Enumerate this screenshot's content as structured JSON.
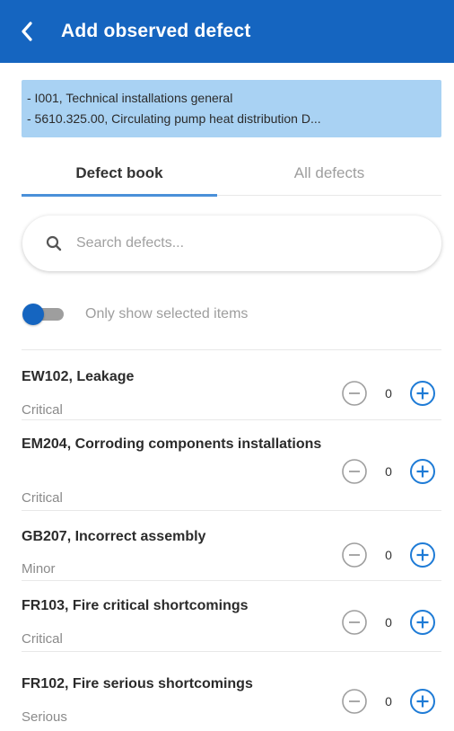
{
  "header": {
    "title": "Add observed defect"
  },
  "context": {
    "lines": [
      "- I001, Technical installations general",
      "- 5610.325.00, Circulating pump heat distribution D..."
    ]
  },
  "tabs": [
    {
      "label": "Defect book",
      "active": true
    },
    {
      "label": "All defects",
      "active": false
    }
  ],
  "search": {
    "placeholder": "Search defects..."
  },
  "filter": {
    "label": "Only show selected items",
    "enabled": false
  },
  "defects": [
    {
      "title": "EW102, Leakage",
      "severity": "Critical",
      "count": "0"
    },
    {
      "title": "EM204, Corroding components installations",
      "severity": "Critical",
      "count": "0"
    },
    {
      "title": "GB207, Incorrect assembly",
      "severity": "Minor",
      "count": "0"
    },
    {
      "title": "FR103, Fire critical shortcomings",
      "severity": "Critical",
      "count": "0"
    },
    {
      "title": "FR102, Fire serious shortcomings",
      "severity": "Serious",
      "count": "0"
    }
  ],
  "colors": {
    "header": "#1565c0",
    "context_bg": "#a9d2f3",
    "accent": "#1e7bd6",
    "muted": "#9e9e9e"
  },
  "icons": {
    "back": "chevron-left-icon",
    "search": "search-icon",
    "decrement": "minus-circle-icon",
    "increment": "plus-circle-icon"
  }
}
